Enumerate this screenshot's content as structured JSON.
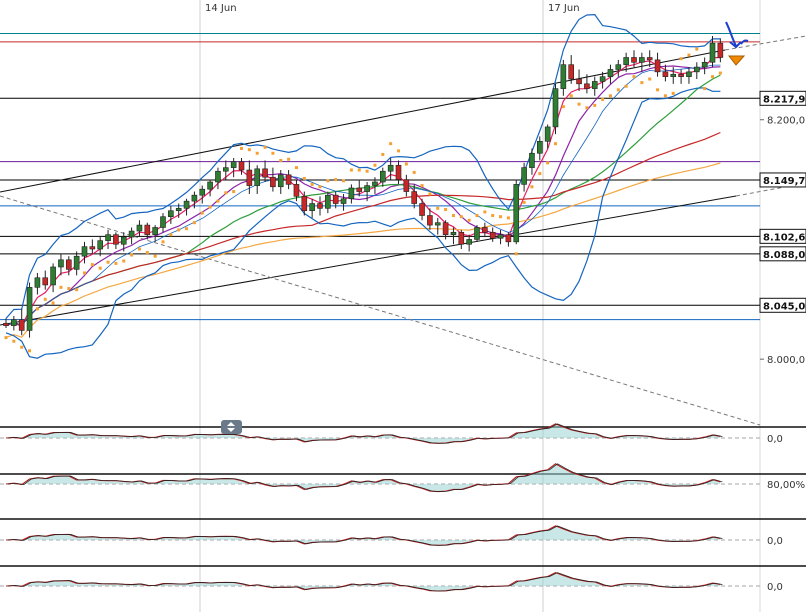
{
  "chart_data": [
    {
      "type": "candlestick",
      "x_labels": [
        {
          "label": "14 Jun",
          "index": 40
        },
        {
          "label": "17 Jun",
          "index": 108
        }
      ],
      "y_ticks": [
        "8.200,0",
        "8.000,0"
      ],
      "y_tick_values": [
        8200,
        8000
      ],
      "ylim": [
        7945,
        8290
      ],
      "price_tags": [
        {
          "label": "8.217,9",
          "value": 8217.9,
          "color": "#000000"
        },
        {
          "label": "8.149,7",
          "value": 8149.7,
          "color": "#1a1a1a"
        },
        {
          "label": "8.102,6",
          "value": 8102.6,
          "color": "#1a1a1a"
        },
        {
          "label": "8.088,0",
          "value": 8088.0,
          "color": "#1a1a1a"
        },
        {
          "label": "8.045,0",
          "value": 8045.0,
          "color": "#1a1a1a"
        }
      ],
      "horizontal_lines": [
        {
          "value": 8217.9,
          "color": "#000000"
        },
        {
          "value": 8149.7,
          "color": "#000000"
        },
        {
          "value": 8102.6,
          "color": "#000000"
        },
        {
          "value": 8088.0,
          "color": "#000000"
        },
        {
          "value": 8045.0,
          "color": "#000000"
        },
        {
          "value": 8165.0,
          "color": "#6a1b9a"
        },
        {
          "value": 8128.0,
          "color": "#1565c0"
        },
        {
          "value": 8033.0,
          "color": "#1565c0"
        },
        {
          "value": 8265.0,
          "color": "#c62828"
        },
        {
          "value": 8272.0,
          "color": "#00838f"
        }
      ],
      "candles": [
        [
          8030,
          8034,
          8026,
          8028
        ],
        [
          8028,
          8036,
          8024,
          8033
        ],
        [
          8033,
          8042,
          8020,
          8024
        ],
        [
          8024,
          8064,
          8018,
          8060
        ],
        [
          8060,
          8072,
          8054,
          8068
        ],
        [
          8068,
          8074,
          8058,
          8062
        ],
        [
          8062,
          8080,
          8056,
          8077
        ],
        [
          8077,
          8088,
          8070,
          8083
        ],
        [
          8083,
          8086,
          8070,
          8075
        ],
        [
          8075,
          8090,
          8070,
          8086
        ],
        [
          8086,
          8098,
          8080,
          8094
        ],
        [
          8094,
          8100,
          8088,
          8092
        ],
        [
          8092,
          8102,
          8086,
          8099
        ],
        [
          8099,
          8108,
          8092,
          8104
        ],
        [
          8104,
          8106,
          8092,
          8096
        ],
        [
          8096,
          8106,
          8090,
          8102
        ],
        [
          8102,
          8110,
          8096,
          8107
        ],
        [
          8107,
          8116,
          8102,
          8112
        ],
        [
          8112,
          8114,
          8100,
          8104
        ],
        [
          8104,
          8112,
          8098,
          8110
        ],
        [
          8110,
          8122,
          8106,
          8119
        ],
        [
          8119,
          8128,
          8113,
          8124
        ],
        [
          8124,
          8130,
          8118,
          8126
        ],
        [
          8126,
          8134,
          8120,
          8132
        ],
        [
          8132,
          8140,
          8126,
          8137
        ],
        [
          8137,
          8145,
          8130,
          8142
        ],
        [
          8142,
          8150,
          8136,
          8148
        ],
        [
          8148,
          8160,
          8142,
          8157
        ],
        [
          8157,
          8166,
          8150,
          8160
        ],
        [
          8160,
          8168,
          8152,
          8165
        ],
        [
          8165,
          8168,
          8154,
          8158
        ],
        [
          8158,
          8166,
          8138,
          8145
        ],
        [
          8145,
          8162,
          8138,
          8159
        ],
        [
          8159,
          8166,
          8148,
          8152
        ],
        [
          8152,
          8160,
          8140,
          8144
        ],
        [
          8144,
          8158,
          8138,
          8154
        ],
        [
          8154,
          8158,
          8142,
          8146
        ],
        [
          8146,
          8150,
          8132,
          8136
        ],
        [
          8136,
          8140,
          8120,
          8124
        ],
        [
          8124,
          8134,
          8118,
          8130
        ],
        [
          8130,
          8136,
          8120,
          8126
        ],
        [
          8126,
          8140,
          8122,
          8137
        ],
        [
          8137,
          8140,
          8126,
          8130
        ],
        [
          8130,
          8138,
          8124,
          8134
        ],
        [
          8134,
          8146,
          8130,
          8143
        ],
        [
          8143,
          8150,
          8136,
          8140
        ],
        [
          8140,
          8148,
          8132,
          8145
        ],
        [
          8145,
          8152,
          8138,
          8148
        ],
        [
          8148,
          8160,
          8144,
          8157
        ],
        [
          8157,
          8168,
          8150,
          8162
        ],
        [
          8162,
          8166,
          8146,
          8150
        ],
        [
          8150,
          8154,
          8136,
          8140
        ],
        [
          8140,
          8146,
          8126,
          8130
        ],
        [
          8130,
          8134,
          8116,
          8120
        ],
        [
          8120,
          8126,
          8108,
          8112
        ],
        [
          8112,
          8118,
          8104,
          8114
        ],
        [
          8114,
          8116,
          8100,
          8104
        ],
        [
          8104,
          8110,
          8096,
          8106
        ],
        [
          8106,
          8108,
          8092,
          8096
        ],
        [
          8096,
          8104,
          8090,
          8100
        ],
        [
          8100,
          8112,
          8098,
          8110
        ],
        [
          8110,
          8114,
          8102,
          8106
        ],
        [
          8106,
          8110,
          8098,
          8101
        ],
        [
          8101,
          8108,
          8096,
          8104
        ],
        [
          8104,
          8106,
          8094,
          8098
        ],
        [
          8098,
          8150,
          8096,
          8146
        ],
        [
          8146,
          8164,
          8140,
          8160
        ],
        [
          8160,
          8176,
          8154,
          8172
        ],
        [
          8172,
          8186,
          8166,
          8182
        ],
        [
          8182,
          8196,
          8176,
          8194
        ],
        [
          8194,
          8230,
          8188,
          8226
        ],
        [
          8226,
          8250,
          8220,
          8246
        ],
        [
          8246,
          8254,
          8230,
          8234
        ],
        [
          8234,
          8242,
          8224,
          8230
        ],
        [
          8230,
          8238,
          8222,
          8226
        ],
        [
          8226,
          8236,
          8220,
          8232
        ],
        [
          8232,
          8240,
          8226,
          8236
        ],
        [
          8236,
          8246,
          8230,
          8242
        ],
        [
          8242,
          8250,
          8236,
          8246
        ],
        [
          8246,
          8256,
          8240,
          8252
        ],
        [
          8252,
          8258,
          8244,
          8248
        ],
        [
          8248,
          8256,
          8240,
          8252
        ],
        [
          8252,
          8258,
          8244,
          8250
        ],
        [
          8250,
          8256,
          8236,
          8240
        ],
        [
          8240,
          8246,
          8232,
          8236
        ],
        [
          8236,
          8244,
          8230,
          8238
        ],
        [
          8238,
          8242,
          8230,
          8236
        ],
        [
          8236,
          8244,
          8230,
          8240
        ],
        [
          8240,
          8248,
          8234,
          8244
        ],
        [
          8244,
          8252,
          8238,
          8248
        ],
        [
          8248,
          8270,
          8244,
          8264
        ],
        [
          8264,
          8268,
          8248,
          8252
        ]
      ],
      "indicator_ticks": [
        "0,0",
        "80,00%",
        "0,0",
        "0,0"
      ]
    }
  ],
  "colors": {
    "up_candle": "#2e7d32",
    "down_candle": "#c62828",
    "bollinger": "#1565c0",
    "sar_dots": "#f5a030",
    "ma_fast": "#e91e63",
    "ma_purple": "#8e24aa",
    "ma_green": "#2e9e3a",
    "ma_red": "#c62828",
    "ma_orange": "#f4a742",
    "trend_lines": "#111111",
    "annotation_arrow": "#1a3fcf",
    "marker": "#f08a00"
  }
}
